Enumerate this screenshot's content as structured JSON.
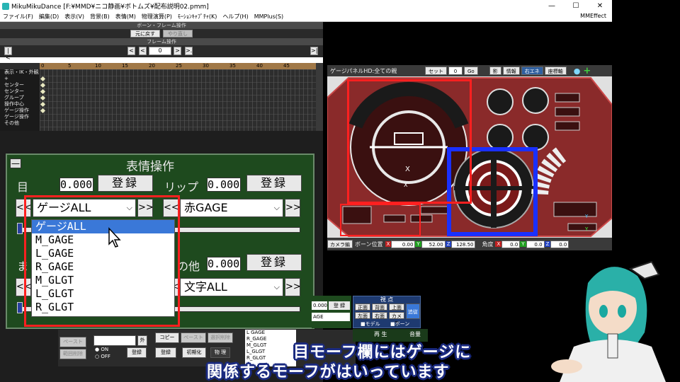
{
  "window": {
    "title": "MikuMikuDance [F:¥MMD¥ニコ静画¥ボトムズ¥配布説明02.pmm]",
    "controls": [
      "—",
      "☐",
      "✕"
    ]
  },
  "menu": {
    "items": [
      "ファイル(F)",
      "編集(D)",
      "表示(V)",
      "背景(B)",
      "表情(M)",
      "物理演算(P)",
      "ﾓｰｼｮﾝｷｬﾌﾟﾁｬ(K)",
      "ヘルプ(H)",
      "MMPlus(S)"
    ],
    "right": "MMEffect"
  },
  "bone_frame": {
    "header": "ボーン・フレーム操作",
    "undo": "元に戻す",
    "redo": "やり直し"
  },
  "frame_op": {
    "header": "フレーム操作",
    "value": "0",
    "first": "|<",
    "prev_key": "<",
    "prev": "<",
    "next": ">",
    "next_key": ">.",
    "last": ">|"
  },
  "timeline": {
    "ticks": [
      "0",
      "5",
      "10",
      "15",
      "20",
      "25",
      "30",
      "35",
      "40",
      "45"
    ],
    "tracks": [
      "表示・IK・外観",
      "+",
      "センター",
      "センター",
      "グループ",
      "操作中心",
      "ゲージ操作",
      "ゲージ操作",
      "その他"
    ]
  },
  "morph": {
    "title": "表情操作",
    "minimize": "—",
    "eye": {
      "label": "目",
      "value": "0.000",
      "register": "登録",
      "selected": "ゲージALL"
    },
    "lip": {
      "label": "リップ",
      "value": "0.000",
      "register": "登録",
      "selected": "赤GAGE"
    },
    "other": {
      "label": "の他",
      "value": "0.000",
      "register": "登録",
      "selected": "文字ALL"
    },
    "nav_prev": "<<",
    "nav_next": ">>",
    "dropdown_items": [
      "ゲージALL",
      "M_GAGE",
      "L_GAGE",
      "R_GAGE",
      "M_GLGT",
      "L_GLGT",
      "R_GLGT"
    ],
    "hidden_left_label": "ま"
  },
  "gauge_panel": {
    "header": "ゲージパネルHD:全ての親",
    "set_label": "セット",
    "set_value": "0",
    "go": "Go",
    "buttons": [
      "影",
      "情報",
      "右エネ",
      "座標軸"
    ],
    "active_button": "右エネ",
    "camera": "カメラ編",
    "bone_pos": "ボーン位置",
    "pos": {
      "x": "0.00",
      "y": "52.00",
      "z": "128.50"
    },
    "angle_label": "角度",
    "angle": {
      "x": "0.0",
      "y": "0.0",
      "z": "0.0"
    },
    "axis_x": "X",
    "axis_y": "Y",
    "axis_z": "Z"
  },
  "lower_left": {
    "btn_copy": "コピー",
    "btn_paste": "ペースト",
    "btn_range_del": "範囲削除",
    "btn_select_del": "選択削除",
    "btn_reg": "登録",
    "btn_init": "初期化",
    "btn_physics": "物 理",
    "btn_out": "外",
    "radio_on": "ON",
    "radio_off": "OFF",
    "partial_items": [
      "L GAGE",
      "R_GAGE",
      "M_GLGT",
      "L_GLGT",
      "R_GLGT"
    ],
    "partial_val": "0.000",
    "partial_reg": "登 録",
    "partial_sel": "AGE"
  },
  "viewpoint": {
    "title": "視 点",
    "buttons": [
      "正面",
      "背面",
      "上面",
      "左面",
      "右面",
      "カメラ"
    ],
    "follow": "追従",
    "model": "■モデル",
    "bone": "■ボーン",
    "play": "再 生",
    "sound": "音量"
  },
  "subtitle": {
    "line1": "目モーフ欄にはゲージに",
    "line2": "関係するモーフがはいっています"
  },
  "colors": {
    "accent_red": "#ff2020",
    "accent_blue": "#1a30ff",
    "panel_green": "#1e4a1e",
    "gauge_red": "#9a2a2a",
    "selection": "#3a78d8"
  }
}
